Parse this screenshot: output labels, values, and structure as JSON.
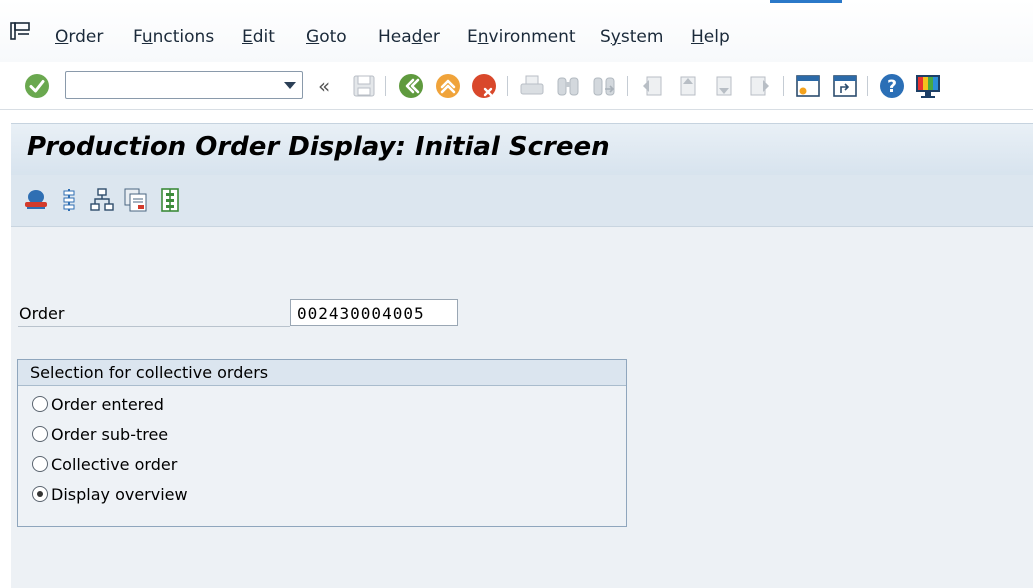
{
  "menu": {
    "items": [
      {
        "id": "order",
        "pre": "",
        "u": "O",
        "post": "rder"
      },
      {
        "id": "functions",
        "pre": "F",
        "u": "u",
        "post": "nctions"
      },
      {
        "id": "edit",
        "pre": "",
        "u": "E",
        "post": "dit"
      },
      {
        "id": "goto",
        "pre": "",
        "u": "G",
        "post": "oto"
      },
      {
        "id": "header",
        "pre": "Hea",
        "u": "d",
        "post": "er"
      },
      {
        "id": "environment",
        "pre": "E",
        "u": "n",
        "post": "vironment"
      },
      {
        "id": "system",
        "pre": "S",
        "u": "y",
        "post": "stem"
      },
      {
        "id": "help",
        "pre": "",
        "u": "H",
        "post": "elp"
      }
    ]
  },
  "toolbar": {
    "command_value": "",
    "icons": [
      "enter-icon",
      "save-icon",
      "back-icon",
      "exit-icon",
      "cancel-icon",
      "print-icon",
      "find-icon",
      "find-next-icon",
      "first-page-icon",
      "previous-page-icon",
      "next-page-icon",
      "last-page-icon",
      "create-session-icon",
      "shortcut-icon",
      "help-icon",
      "customize-layout-icon"
    ]
  },
  "title": "Production Order Display: Initial Screen",
  "app_toolbar": {
    "icons": [
      "header-hat-icon",
      "operations-icon",
      "component-structure-icon",
      "documents-icon",
      "sequences-icon"
    ]
  },
  "form": {
    "order_label": "Order",
    "order_value": "002430004005"
  },
  "selection": {
    "title": "Selection for collective orders",
    "options": [
      {
        "label": "Order entered",
        "checked": false
      },
      {
        "label": "Order sub-tree",
        "checked": false
      },
      {
        "label": "Collective order",
        "checked": false
      },
      {
        "label": "Display overview",
        "checked": true
      }
    ]
  },
  "colors": {
    "accent_blue": "#2a78c8",
    "title_bg": "#d7e3ee",
    "content_bg": "#edf1f5",
    "enter_green": "#6aa84f",
    "cancel_red": "#d9482b",
    "exit_orange": "#f0a33a"
  }
}
